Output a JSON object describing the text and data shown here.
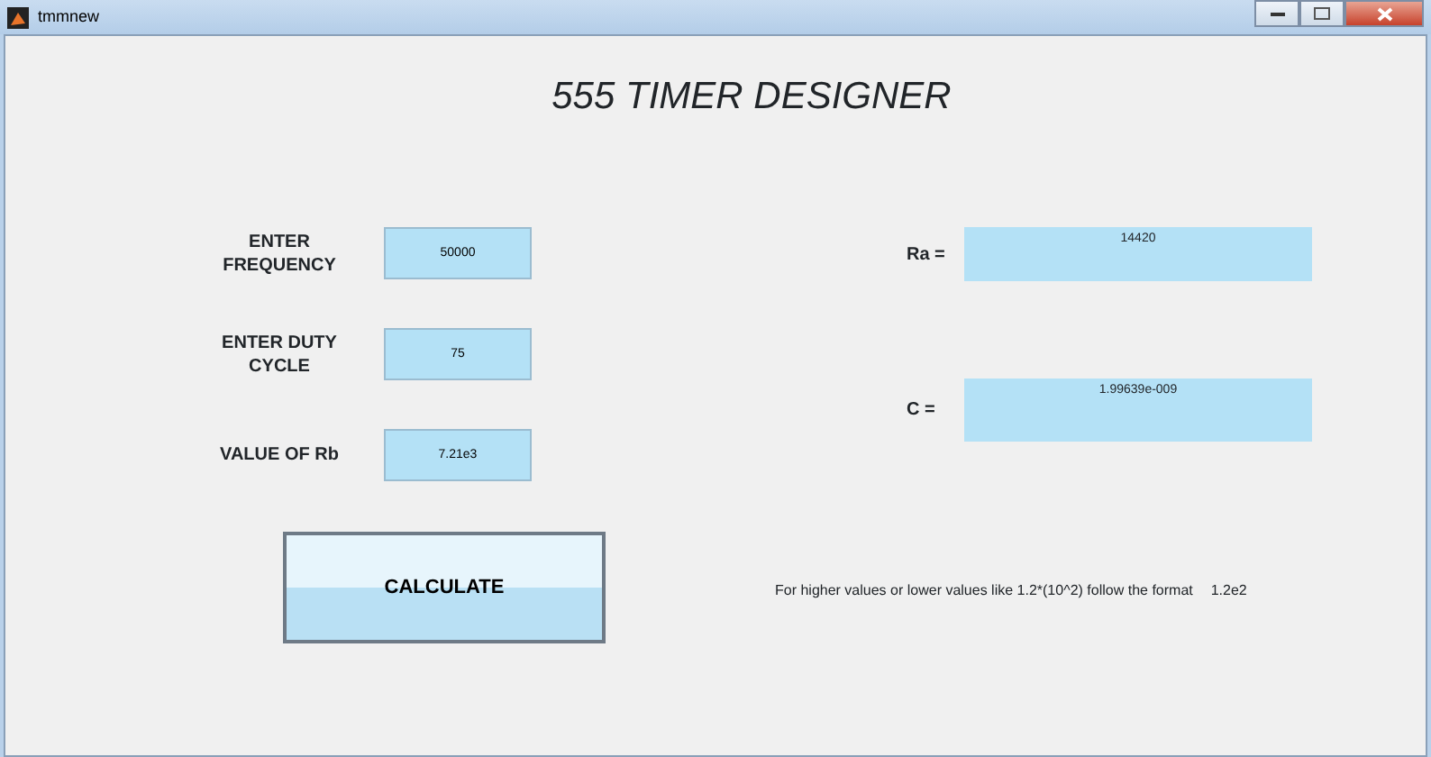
{
  "window": {
    "title": "tmmnew"
  },
  "heading": "555 TIMER DESIGNER",
  "inputs": [
    {
      "label": "ENTER FREQUENCY",
      "value": "50000"
    },
    {
      "label": "ENTER DUTY CYCLE",
      "value": "75"
    },
    {
      "label": "VALUE OF Rb",
      "value": "7.21e3"
    }
  ],
  "outputs": [
    {
      "label": "Ra =",
      "value": "14420"
    },
    {
      "label": "C =",
      "value": "1.99639e-009"
    }
  ],
  "button": "CALCULATE",
  "hint": "For higher values or lower values like 1.2*(10^2) follow the format",
  "hint_example": "1.2e2"
}
